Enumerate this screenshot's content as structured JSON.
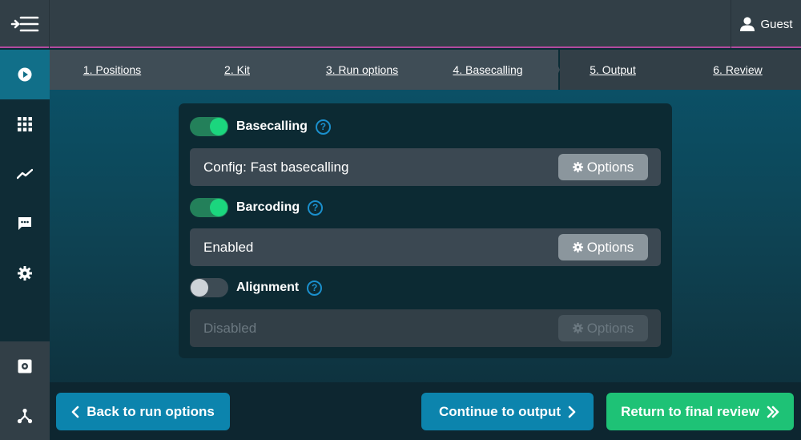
{
  "header": {
    "menu_icon": "menu-collapse-icon",
    "user_icon": "user-icon",
    "user_name": "Guest"
  },
  "sidebar": {
    "items": [
      {
        "icon": "play-icon",
        "active": true
      },
      {
        "icon": "grid-icon",
        "active": false
      },
      {
        "icon": "trend-icon",
        "active": false
      },
      {
        "icon": "chat-icon",
        "active": false
      },
      {
        "icon": "gear-icon",
        "active": false
      }
    ],
    "bottom_items": [
      {
        "icon": "settings-box-icon"
      },
      {
        "icon": "network-icon"
      }
    ]
  },
  "steps": [
    {
      "label": "1. Positions",
      "state": "done"
    },
    {
      "label": "2. Kit",
      "state": "done"
    },
    {
      "label": "3. Run options",
      "state": "done"
    },
    {
      "label": "4. Basecalling",
      "state": "current"
    },
    {
      "label": "5. Output",
      "state": "todo"
    },
    {
      "label": "6. Review",
      "state": "todo"
    }
  ],
  "sections": {
    "basecalling": {
      "title": "Basecalling",
      "enabled": true,
      "detail": "Config: Fast basecalling",
      "options_label": "Options",
      "help": "?"
    },
    "barcoding": {
      "title": "Barcoding",
      "enabled": true,
      "detail": "Enabled",
      "options_label": "Options",
      "help": "?"
    },
    "alignment": {
      "title": "Alignment",
      "enabled": false,
      "detail": "Disabled",
      "options_label": "Options",
      "help": "?"
    }
  },
  "footer": {
    "back_label": "Back to run options",
    "continue_label": "Continue to output",
    "review_label": "Return to final review"
  },
  "colors": {
    "accent_blue": "#0c84ad",
    "accent_green": "#1ec276",
    "toggle_on": "#1bd67e",
    "help_blue": "#1b90cd",
    "topbar": "#323f47",
    "header_rule": "#b24a9e"
  }
}
